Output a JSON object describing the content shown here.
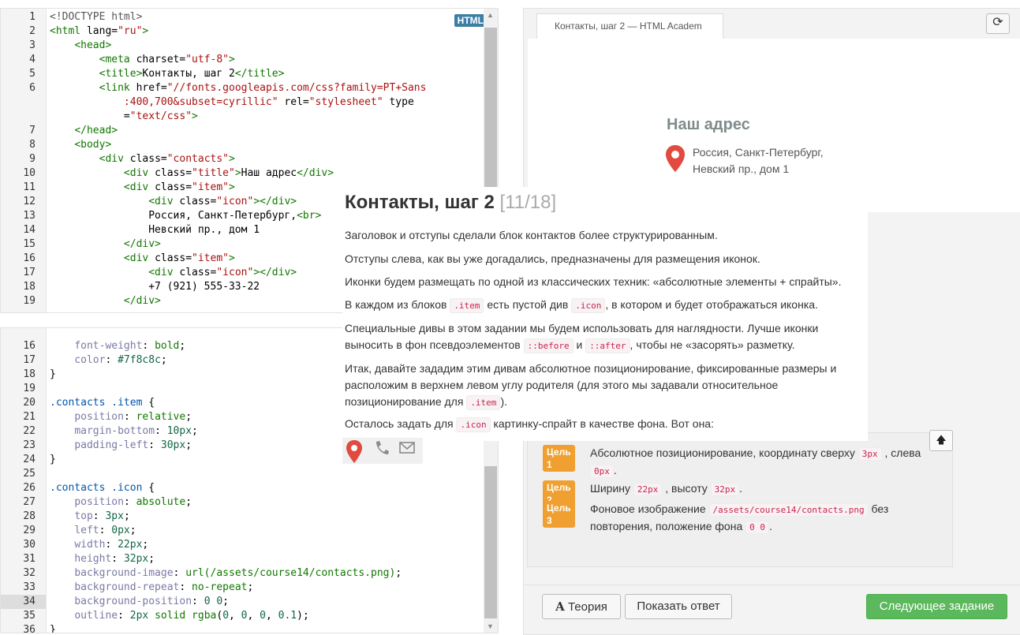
{
  "html_editor": {
    "badge": "HTML",
    "lines": [
      {
        "n": "1",
        "segments": [
          [
            "t-meta",
            "<!DOCTYPE html>"
          ]
        ]
      },
      {
        "n": "2",
        "segments": [
          [
            "t-tag",
            "<html "
          ],
          [
            "t-attr",
            "lang="
          ],
          [
            "t-str",
            "\"ru\""
          ],
          [
            "t-tag",
            ">"
          ]
        ]
      },
      {
        "n": "3",
        "segments": [
          [
            "",
            "    "
          ],
          [
            "t-tag",
            "<head>"
          ]
        ]
      },
      {
        "n": "4",
        "segments": [
          [
            "",
            "        "
          ],
          [
            "t-tag",
            "<meta "
          ],
          [
            "t-attr",
            "charset="
          ],
          [
            "t-str",
            "\"utf-8\""
          ],
          [
            "t-tag",
            ">"
          ]
        ]
      },
      {
        "n": "5",
        "segments": [
          [
            "",
            "        "
          ],
          [
            "t-tag",
            "<title>"
          ],
          [
            "",
            "Контакты, шаг 2"
          ],
          [
            "t-tag",
            "</title>"
          ]
        ]
      },
      {
        "n": "6",
        "segments": [
          [
            "",
            "        "
          ],
          [
            "t-tag",
            "<link "
          ],
          [
            "t-attr",
            "href="
          ],
          [
            "t-str",
            "\"//fonts.googleapis.com/css?family=PT+Sans"
          ]
        ]
      },
      {
        "n": "",
        "segments": [
          [
            "",
            "            "
          ],
          [
            "t-str",
            ":400,700&subset=cyrillic\""
          ],
          [
            "t-attr",
            " rel="
          ],
          [
            "t-str",
            "\"stylesheet\""
          ],
          [
            "t-attr",
            " type"
          ]
        ]
      },
      {
        "n": "",
        "segments": [
          [
            "",
            "            "
          ],
          [
            "t-attr",
            "="
          ],
          [
            "t-str",
            "\"text/css\""
          ],
          [
            "t-tag",
            ">"
          ]
        ]
      },
      {
        "n": "7",
        "segments": [
          [
            "",
            "    "
          ],
          [
            "t-tag",
            "</head>"
          ]
        ]
      },
      {
        "n": "8",
        "segments": [
          [
            "",
            "    "
          ],
          [
            "t-tag",
            "<body>"
          ]
        ]
      },
      {
        "n": "9",
        "segments": [
          [
            "",
            "        "
          ],
          [
            "t-tag",
            "<div "
          ],
          [
            "t-attr",
            "class="
          ],
          [
            "t-str",
            "\"contacts\""
          ],
          [
            "t-tag",
            ">"
          ]
        ]
      },
      {
        "n": "10",
        "segments": [
          [
            "",
            "            "
          ],
          [
            "t-tag",
            "<div "
          ],
          [
            "t-attr",
            "class="
          ],
          [
            "t-str",
            "\"title\""
          ],
          [
            "t-tag",
            ">"
          ],
          [
            "",
            "Наш адрес"
          ],
          [
            "t-tag",
            "</div>"
          ]
        ]
      },
      {
        "n": "11",
        "segments": [
          [
            "",
            "            "
          ],
          [
            "t-tag",
            "<div "
          ],
          [
            "t-attr",
            "class="
          ],
          [
            "t-str",
            "\"item\""
          ],
          [
            "t-tag",
            ">"
          ]
        ]
      },
      {
        "n": "12",
        "segments": [
          [
            "",
            "                "
          ],
          [
            "t-tag",
            "<div "
          ],
          [
            "t-attr",
            "class="
          ],
          [
            "t-str",
            "\"icon\""
          ],
          [
            "t-tag",
            "></div>"
          ]
        ]
      },
      {
        "n": "13",
        "segments": [
          [
            "",
            "                Россия, Санкт-Петербург,"
          ],
          [
            "t-tag",
            "<br>"
          ]
        ]
      },
      {
        "n": "14",
        "segments": [
          [
            "",
            "                Невский пр., дом 1"
          ]
        ]
      },
      {
        "n": "15",
        "segments": [
          [
            "",
            "            "
          ],
          [
            "t-tag",
            "</div>"
          ]
        ]
      },
      {
        "n": "16",
        "segments": [
          [
            "",
            "            "
          ],
          [
            "t-tag",
            "<div "
          ],
          [
            "t-attr",
            "class="
          ],
          [
            "t-str",
            "\"item\""
          ],
          [
            "t-tag",
            ">"
          ]
        ]
      },
      {
        "n": "17",
        "segments": [
          [
            "",
            "                "
          ],
          [
            "t-tag",
            "<div "
          ],
          [
            "t-attr",
            "class="
          ],
          [
            "t-str",
            "\"icon\""
          ],
          [
            "t-tag",
            "></div>"
          ]
        ]
      },
      {
        "n": "18",
        "segments": [
          [
            "",
            "                +7 (921) 555-33-22"
          ]
        ]
      },
      {
        "n": "19",
        "segments": [
          [
            "",
            "            "
          ],
          [
            "t-tag",
            "</div>"
          ]
        ]
      }
    ]
  },
  "css_editor": {
    "lines": [
      {
        "n": "16",
        "segments": [
          [
            "",
            "    "
          ],
          [
            "t-prop",
            "font-weight"
          ],
          [
            "",
            ": "
          ],
          [
            "t-val",
            "bold"
          ],
          [
            "",
            ";"
          ]
        ]
      },
      {
        "n": "17",
        "segments": [
          [
            "",
            "    "
          ],
          [
            "t-prop",
            "color"
          ],
          [
            "",
            ": "
          ],
          [
            "t-num",
            "#7f8c8c"
          ],
          [
            "",
            ";"
          ]
        ]
      },
      {
        "n": "18",
        "segments": [
          [
            "",
            "}"
          ]
        ]
      },
      {
        "n": "19",
        "segments": [
          [
            "",
            ""
          ]
        ]
      },
      {
        "n": "20",
        "segments": [
          [
            "t-sel",
            ".contacts .item"
          ],
          [
            "",
            " {"
          ]
        ]
      },
      {
        "n": "21",
        "segments": [
          [
            "",
            "    "
          ],
          [
            "t-prop",
            "position"
          ],
          [
            "",
            ": "
          ],
          [
            "t-val",
            "relative"
          ],
          [
            "",
            ";"
          ]
        ]
      },
      {
        "n": "22",
        "segments": [
          [
            "",
            "    "
          ],
          [
            "t-prop",
            "margin-bottom"
          ],
          [
            "",
            ": "
          ],
          [
            "t-num",
            "10px"
          ],
          [
            "",
            ";"
          ]
        ]
      },
      {
        "n": "23",
        "segments": [
          [
            "",
            "    "
          ],
          [
            "t-prop",
            "padding-left"
          ],
          [
            "",
            ": "
          ],
          [
            "t-num",
            "30px"
          ],
          [
            "",
            ";"
          ]
        ]
      },
      {
        "n": "24",
        "segments": [
          [
            "",
            "}"
          ]
        ]
      },
      {
        "n": "25",
        "segments": [
          [
            "",
            ""
          ]
        ]
      },
      {
        "n": "26",
        "segments": [
          [
            "t-sel",
            ".contacts .icon"
          ],
          [
            "",
            " {"
          ]
        ]
      },
      {
        "n": "27",
        "segments": [
          [
            "",
            "    "
          ],
          [
            "t-prop",
            "position"
          ],
          [
            "",
            ": "
          ],
          [
            "t-val",
            "absolute"
          ],
          [
            "",
            ";"
          ]
        ]
      },
      {
        "n": "28",
        "segments": [
          [
            "",
            "    "
          ],
          [
            "t-prop",
            "top"
          ],
          [
            "",
            ": "
          ],
          [
            "t-num",
            "3px"
          ],
          [
            "",
            ";"
          ]
        ]
      },
      {
        "n": "29",
        "segments": [
          [
            "",
            "    "
          ],
          [
            "t-prop",
            "left"
          ],
          [
            "",
            ": "
          ],
          [
            "t-num",
            "0px"
          ],
          [
            "",
            ";"
          ]
        ]
      },
      {
        "n": "30",
        "segments": [
          [
            "",
            "    "
          ],
          [
            "t-prop",
            "width"
          ],
          [
            "",
            ": "
          ],
          [
            "t-num",
            "22px"
          ],
          [
            "",
            ";"
          ]
        ]
      },
      {
        "n": "31",
        "segments": [
          [
            "",
            "    "
          ],
          [
            "t-prop",
            "height"
          ],
          [
            "",
            ": "
          ],
          [
            "t-num",
            "32px"
          ],
          [
            "",
            ";"
          ]
        ]
      },
      {
        "n": "32",
        "segments": [
          [
            "",
            "    "
          ],
          [
            "t-prop",
            "background-image"
          ],
          [
            "",
            ": "
          ],
          [
            "t-val",
            "url(/assets/course14/contacts.png)"
          ],
          [
            "",
            ";"
          ]
        ]
      },
      {
        "n": "33",
        "segments": [
          [
            "",
            "    "
          ],
          [
            "t-prop",
            "background-repeat"
          ],
          [
            "",
            ": "
          ],
          [
            "t-val",
            "no-repeat"
          ],
          [
            "",
            ";"
          ]
        ]
      },
      {
        "n": "34",
        "segments": [
          [
            "",
            "    "
          ],
          [
            "t-prop",
            "background-position"
          ],
          [
            "",
            ": "
          ],
          [
            "t-num",
            "0 0"
          ],
          [
            "",
            ";"
          ]
        ],
        "active": true
      },
      {
        "n": "35",
        "segments": [
          [
            "",
            "    "
          ],
          [
            "t-prop",
            "outline"
          ],
          [
            "",
            ": "
          ],
          [
            "t-num",
            "2px"
          ],
          [
            "",
            " "
          ],
          [
            "t-val",
            "solid rgba"
          ],
          [
            "",
            "("
          ],
          [
            "t-num",
            "0"
          ],
          [
            ",",
            ""
          ],
          [
            "",
            ","
          ],
          [
            "t-num",
            " 0"
          ],
          [
            "",
            ","
          ],
          [
            "t-num",
            " 0"
          ],
          [
            "",
            ","
          ],
          [
            "t-num",
            " 0.1"
          ],
          [
            "",
            ")"
          ],
          [
            "",
            ";"
          ]
        ]
      },
      {
        "n": "36",
        "segments": [
          [
            "",
            "}"
          ]
        ]
      }
    ]
  },
  "preview": {
    "tab_title": "Контакты, шаг 2 — HTML Academ",
    "title": "Наш адрес",
    "address_line1": "Россия, Санкт-Петербург,",
    "address_line2": "Невский пр., дом 1"
  },
  "instructions": {
    "title": "Контакты, шаг 2",
    "counter": "[11/18]",
    "p1": "Заголовок и отступы сделали блок контактов более структурированным.",
    "p2": "Отступы слева, как вы уже догадались, предназначены для размещения иконок.",
    "p3": "Иконки будем размещать по одной из классических техник: «абсолютные элементы + спрайты».",
    "p4_a": "В каждом из блоков",
    "p4_code1": ".item",
    "p4_b": "есть пустой див",
    "p4_code2": ".icon",
    "p4_c": ", в котором и будет отображаться иконка.",
    "p5_a": "Специальные дивы в этом задании мы будем использовать для наглядности. Лучше иконки выносить в фон псевдоэлементов",
    "p5_code1": "::before",
    "p5_b": "и",
    "p5_code2": "::after",
    "p5_c": ", чтобы не «засорять» разметку.",
    "p6_a": "Итак, давайте зададим этим дивам абсолютное позиционирование, фиксированные размеры и расположим в верхнем левом углу родителя (для этого мы задавали относительное позиционирование для",
    "p6_code": ".item",
    "p6_b": ").",
    "p7_a": "Осталось задать для",
    "p7_code": ".icon",
    "p7_b": "картинку-спрайт в качестве фона. Вот она:"
  },
  "goals": [
    {
      "badge": "Цель 1",
      "a": "Абсолютное позиционирование, координату сверху",
      "c1": "3px",
      "b": ", слева",
      "c2": "0px",
      "d": "."
    },
    {
      "badge": "Цель 2",
      "a": "Ширину",
      "c1": "22px",
      "b": ", высоту",
      "c2": "32px",
      "d": "."
    },
    {
      "badge": "Цель 3",
      "a": "Фоновое изображение",
      "c1": "/assets/course14/contacts.png",
      "b": "без повторения, положение фона",
      "c2": "0 0",
      "d": "."
    }
  ],
  "buttons": {
    "theory": "Теория",
    "show_answer": "Показать ответ",
    "next_task": "Следующее задание"
  },
  "colors": {
    "accent_green": "#5cb85c",
    "goal_badge": "#f0a030",
    "pin_red": "#e04a3f",
    "preview_title": "#7f8c8c"
  }
}
